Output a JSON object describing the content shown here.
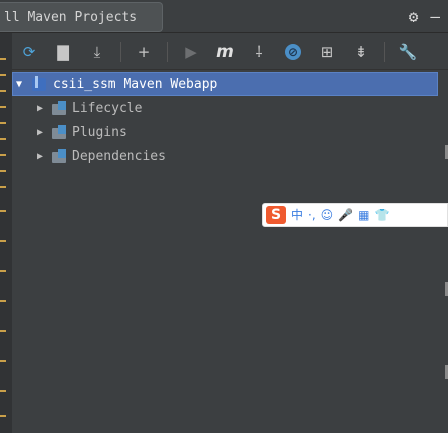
{
  "window": {
    "title": "ll Maven Projects"
  },
  "title_actions": [
    {
      "name": "settings",
      "icon": "gear-icon",
      "glyph": "⚙"
    },
    {
      "name": "minimize",
      "icon": "minimize-icon",
      "glyph": "—"
    }
  ],
  "toolbar": [
    {
      "name": "reimport",
      "icon": "refresh-icon",
      "glyph": "⟳"
    },
    {
      "name": "generate-sources",
      "icon": "folder-refresh-icon",
      "glyph": "▇"
    },
    {
      "name": "download",
      "icon": "download-icon",
      "glyph": "⤓"
    },
    {
      "name": "add",
      "icon": "plus-icon",
      "glyph": "+"
    },
    {
      "name": "run",
      "icon": "run-icon",
      "glyph": "▶"
    },
    {
      "name": "execute-goal",
      "icon": "maven-goal-icon",
      "glyph": "m"
    },
    {
      "name": "toggle-offline",
      "icon": "offline-icon",
      "glyph": "⸸"
    },
    {
      "name": "skip-tests",
      "icon": "skip-tests-icon",
      "glyph": "⊘"
    },
    {
      "name": "show-dependencies",
      "icon": "diagram-icon",
      "glyph": "⊞"
    },
    {
      "name": "collapse-all",
      "icon": "collapse-icon",
      "glyph": "⇟"
    },
    {
      "name": "settings",
      "icon": "wrench-icon",
      "glyph": "🔧"
    }
  ],
  "tree": {
    "root": "csii_ssm Maven Webapp",
    "children": [
      {
        "label": "Lifecycle"
      },
      {
        "label": "Plugins"
      },
      {
        "label": "Dependencies"
      }
    ]
  },
  "ime_toolbar": {
    "logo": "S",
    "items": [
      "中",
      "·,",
      "☺",
      "🎤",
      "▦",
      "👕"
    ]
  },
  "colors": {
    "background": "#3c3f41",
    "selection": "#4b6eaf",
    "accent_blue": "#4b8fc7",
    "ime_logo": "#ef5a2f"
  }
}
